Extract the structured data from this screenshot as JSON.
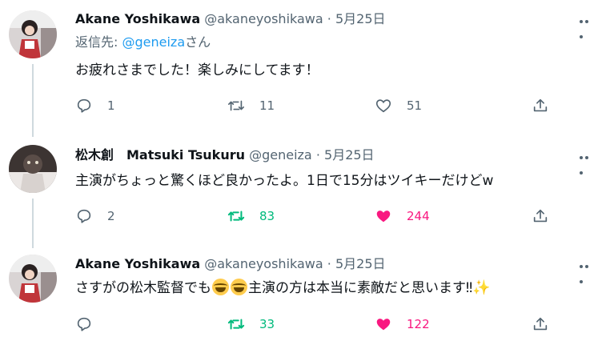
{
  "tweets": [
    {
      "name": "Akane Yoshikawa",
      "handle": "@akaneyoshikawa",
      "dot": "·",
      "date": "5月25日",
      "reply_label": "返信先: ",
      "reply_mention": "@geneiza",
      "reply_suffix": "さん",
      "text": "お疲れさまでした！楽しみにしてます！",
      "replies": "1",
      "retweets": "11",
      "likes": "51"
    },
    {
      "name": "松木創　Matsuki Tsukuru",
      "handle": "@geneiza",
      "dot": "·",
      "date": "5月25日",
      "text": "主演がちょっと驚くほど良かったよ。1日で15分はツイキーだけどw",
      "replies": "2",
      "retweets": "83",
      "likes": "244"
    },
    {
      "name": "Akane Yoshikawa",
      "handle": "@akaneyoshikawa",
      "dot": "·",
      "date": "5月25日",
      "text_a": "さすがの松木監督でも",
      "text_b": "主演の方は本当に素敵だと思います‼",
      "sparkle": "✨",
      "replies": "",
      "retweets": "33",
      "likes": "122"
    }
  ],
  "colors": {
    "accent": "#1d9bf0",
    "retweet_active": "#00ba7c",
    "like_active": "#f91880",
    "muted": "#536471"
  },
  "icons": [
    "more-icon",
    "reply-icon",
    "retweet-icon",
    "like-icon",
    "share-icon",
    "emoji-joy-icon",
    "sparkles-icon"
  ]
}
